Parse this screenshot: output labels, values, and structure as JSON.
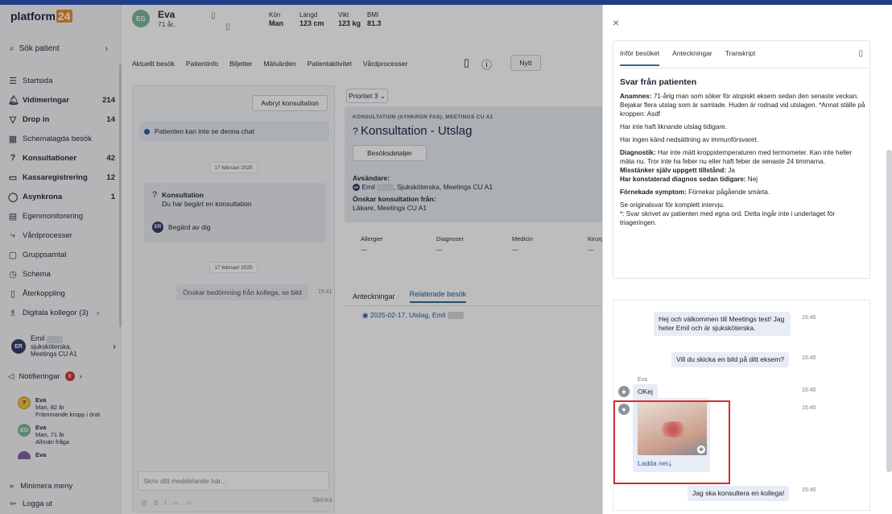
{
  "sidebar": {
    "logo_text": "platform",
    "logo_badge": "24",
    "search_label": "Sök patient",
    "items": [
      {
        "label": "Startsida",
        "count": "",
        "icon": "menu-icon",
        "bold": false
      },
      {
        "label": "Vidimeringar",
        "count": "214",
        "icon": "bell-icon",
        "bold": true
      },
      {
        "label": "Drop in",
        "count": "14",
        "icon": "filter-icon",
        "bold": true
      },
      {
        "label": "Schemalagda besök",
        "count": "",
        "icon": "calendar-icon",
        "bold": false
      },
      {
        "label": "Konsultationer",
        "count": "42",
        "icon": "help-icon",
        "bold": true
      },
      {
        "label": "Kassaregistrering",
        "count": "12",
        "icon": "cash-icon",
        "bold": true
      },
      {
        "label": "Asynkrona",
        "count": "1",
        "icon": "chat-icon",
        "bold": true
      },
      {
        "label": "Egenmonitorering",
        "count": "",
        "icon": "monitor-icon",
        "bold": false
      },
      {
        "label": "Vårdprocesser",
        "count": "",
        "icon": "process-icon",
        "bold": false
      },
      {
        "label": "Gruppsamtal",
        "count": "",
        "icon": "group-icon",
        "bold": false
      },
      {
        "label": "Schema",
        "count": "",
        "icon": "clock-icon",
        "bold": false
      },
      {
        "label": "Återkoppling",
        "count": "",
        "icon": "document-icon",
        "bold": false
      },
      {
        "label": "Digitala kollegor (3)",
        "count": "",
        "icon": "colleagues-icon",
        "bold": false
      }
    ],
    "user": {
      "initials": "ER",
      "name": "Emil",
      "role": "sjuksköterska,",
      "org": "Meetings CU A1"
    },
    "notifications_label": "Notifieringar",
    "notifications_count": "8",
    "queue": [
      {
        "initials": "?",
        "name": "Eva",
        "line1": "Man, 82 år",
        "line2": "Främmande kropp i örat"
      },
      {
        "initials": "EG",
        "name": "Eva",
        "line1": "Man, 71 år",
        "line2": "Allmän fråga"
      },
      {
        "initials": "",
        "name": "Eva",
        "line1": "",
        "line2": ""
      }
    ],
    "minimize_label": "Minimera meny",
    "logout_label": "Logga ut"
  },
  "patient": {
    "initials": "EG",
    "name": "Eva",
    "age": "71 år,",
    "gender_label": "Kön",
    "gender": "Man",
    "height_label": "Längd",
    "height": "123 cm",
    "weight_label": "Vikt",
    "weight": "123 kg",
    "bmi_label": "BMI",
    "bmi": "81.3"
  },
  "nav_tabs": [
    "Aktuellt besök",
    "Patientinfo",
    "Biljetter",
    "Mätvärden",
    "Patientaktivitet",
    "Vårdprocesser"
  ],
  "nytt_label": "Nytt",
  "chat": {
    "abort_label": "Avbryt konsultation",
    "info_text": "Patienten kan inte se denna chat",
    "date1": "17 februari 2025",
    "konsult_title": "Konsultation",
    "konsult_sub": "Du har begärt en konsultation",
    "request_initials": "ER",
    "request_label": "Begärd av dig",
    "date2": "17 februari 2025",
    "ask_text": "Önskar bedömning från kollega, se bild",
    "ask_time": "15:41",
    "composer_placeholder": "Skriv ditt meddelande här...",
    "format_icons": [
      "@",
      "B",
      "I",
      "≔",
      "≔"
    ],
    "send_label": "Skicka"
  },
  "case": {
    "priority": "Prioritet 3",
    "tag": "KONSULTATION (SYNKRON FAS), MEETINGS CU A1",
    "title": "Konsultation - Utslag",
    "details_btn": "Besöksdetaljer",
    "sender_label": "Avsändare:",
    "sender_initials": "ER",
    "sender_name": "Emil",
    "sender_rest": ", Sjuksköterska, Meetings CU A1",
    "from_label": "Önskar konsultation från:",
    "from_value": "Läkare, Meetings CU A1",
    "columns": [
      {
        "label": "Allergier",
        "value": "—"
      },
      {
        "label": "Diagnoser",
        "value": "—"
      },
      {
        "label": "Medicin",
        "value": "—"
      },
      {
        "label": "Kirurgi",
        "value": "—"
      }
    ],
    "tab_notes": "Anteckningar",
    "tab_related": "Relaterade besök",
    "visit_link": "2025-02-17, Utslag, Emil"
  },
  "drawer": {
    "close": "×",
    "tabs": [
      "Inför besöket",
      "Anteckningar",
      "Transkript"
    ],
    "heading": "Svar från patienten",
    "anamnes_label": "Anamnes:",
    "anamnes": "71-årig man som söker för atopiskt eksem sedan den senaste veckan. Bejakar flera utslag som är samlade. Huden är rodnad vid utslagen. *Annat ställe på kroppen: Asdf",
    "p2": "Har inte haft liknande utslag tidigare.",
    "p3": "Har ingen känd nedsättning av immunförsvaret.",
    "diag_label": "Diagnostik:",
    "diag": "Har inte mätt kroppstemperaturen med termometer. Kan inte heller mäta nu. Tror inte ha feber nu eller haft feber de senaste 24 timmarna.",
    "sev_label": "Misstänker själv uppgett tillstånd:",
    "sev": "Ja",
    "conf_label": "Har konstaterad diagnos sedan tidigare:",
    "conf": "Nej",
    "denied_label": "Förnekade symptom:",
    "denied": "Förnekar pågående smärta.",
    "p_orig": "Se originalsvar för komplett intervju.",
    "p_note": "*: Svar skrivet av patienten med egna ord. Detta ingår inte i underlaget för triageringen.",
    "messages": {
      "m1": "Hej och välkommen till Meetings test! Jag heter Emil och är sjuksköterska.",
      "m1_time": "15:40",
      "m2": "Vill du skicka en bild på ditt eksem?",
      "m2_time": "15:40",
      "sender": "Eva",
      "m3": "OKej",
      "m3_time": "15:40",
      "img_time": "15:40",
      "download": "Ladda ner",
      "m4": "Jag ska konsultera en kollega!",
      "m4_time": "15:40"
    }
  }
}
